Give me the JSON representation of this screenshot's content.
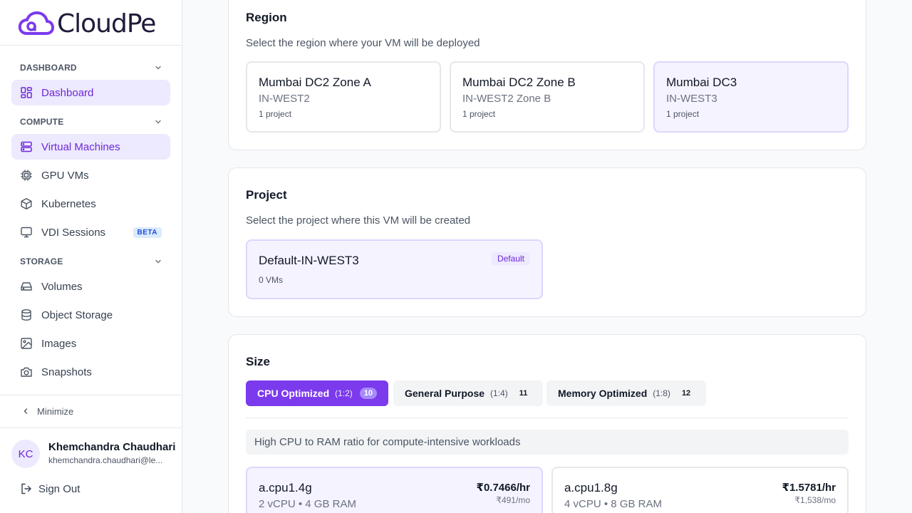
{
  "brand": {
    "name": "CloudPe",
    "accent": "#7c3aed"
  },
  "sidebar": {
    "sections": [
      {
        "label": "DASHBOARD"
      },
      {
        "label": "COMPUTE"
      },
      {
        "label": "STORAGE"
      }
    ],
    "items": [
      {
        "label": "Dashboard",
        "icon": "dashboard-grid-icon",
        "active": true
      },
      {
        "label": "Virtual Machines",
        "icon": "server-icon",
        "active": true
      },
      {
        "label": "GPU VMs",
        "icon": "cpu-chip-icon"
      },
      {
        "label": "Kubernetes",
        "icon": "cube-icon"
      },
      {
        "label": "VDI Sessions",
        "icon": "monitor-icon",
        "badge": "BETA"
      },
      {
        "label": "Volumes",
        "icon": "hard-drive-icon"
      },
      {
        "label": "Object Storage",
        "icon": "database-icon"
      },
      {
        "label": "Images",
        "icon": "image-icon"
      },
      {
        "label": "Snapshots",
        "icon": "camera-icon"
      }
    ],
    "minimize_label": "Minimize",
    "user": {
      "initials": "KC",
      "name": "Khemchandra Chaudhari",
      "email": "khemchandra.chaudhari@le..."
    },
    "signout_label": "Sign Out"
  },
  "region": {
    "title": "Region",
    "subtitle": "Select the region where your VM will be deployed",
    "options": [
      {
        "name": "Mumbai DC2 Zone A",
        "code": "IN-WEST2",
        "meta": "1 project"
      },
      {
        "name": "Mumbai DC2 Zone B",
        "code": "IN-WEST2 Zone B",
        "meta": "1 project"
      },
      {
        "name": "Mumbai DC3",
        "code": "IN-WEST3",
        "meta": "1 project",
        "selected": true
      }
    ]
  },
  "project": {
    "title": "Project",
    "subtitle": "Select the project where this VM will be created",
    "option": {
      "name": "Default-IN-WEST3",
      "meta": "0 VMs",
      "badge": "Default"
    }
  },
  "size": {
    "title": "Size",
    "tabs": [
      {
        "label": "CPU Optimized",
        "ratio": "(1:2)",
        "count": "10",
        "active": true
      },
      {
        "label": "General Purpose",
        "ratio": "(1:4)",
        "count": "11"
      },
      {
        "label": "Memory Optimized",
        "ratio": "(1:8)",
        "count": "12"
      }
    ],
    "description": "High CPU to RAM ratio for compute-intensive workloads",
    "plans": [
      {
        "name": "a.cpu1.4g",
        "spec": "2 vCPU • 4 GB RAM",
        "price_hr": "₹0.7466/hr",
        "price_mo": "₹491/mo",
        "selected": true
      },
      {
        "name": "a.cpu1.8g",
        "spec": "4 vCPU • 8 GB RAM",
        "price_hr": "₹1.5781/hr",
        "price_mo": "₹1,538/mo"
      }
    ]
  }
}
